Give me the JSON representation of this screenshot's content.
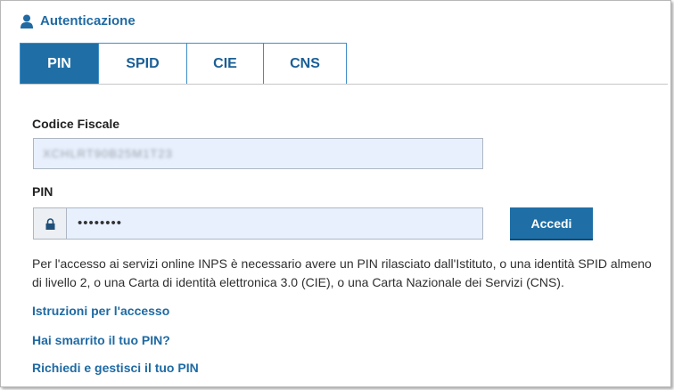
{
  "header": {
    "title": "Autenticazione",
    "icon": "user-icon"
  },
  "tabs": [
    {
      "label": "PIN",
      "active": true
    },
    {
      "label": "SPID",
      "active": false
    },
    {
      "label": "CIE",
      "active": false
    },
    {
      "label": "CNS",
      "active": false
    }
  ],
  "form": {
    "cf_label": "Codice Fiscale",
    "cf_value": "XCHLRT90B25M1T23",
    "pin_label": "PIN",
    "pin_value": "••••••••",
    "lock_icon": "lock-icon",
    "submit_label": "Accedi"
  },
  "info": {
    "text": "Per l'accesso ai servizi online INPS è necessario avere un PIN rilasciato dall'Istituto, o una identità SPID almeno di livello 2, o una Carta di identità elettronica 3.0 (CIE), o una Carta Nazionale dei Servizi (CNS)."
  },
  "links": {
    "instructions": "Istruzioni per l'accesso",
    "lost_pin": "Hai smarrito il tuo PIN?",
    "request_pin": "Richiedi e gestisci il tuo PIN"
  },
  "colors": {
    "primary": "#1f6fa6",
    "link": "#1f6aa3",
    "input_bg": "#e8f0fe"
  }
}
